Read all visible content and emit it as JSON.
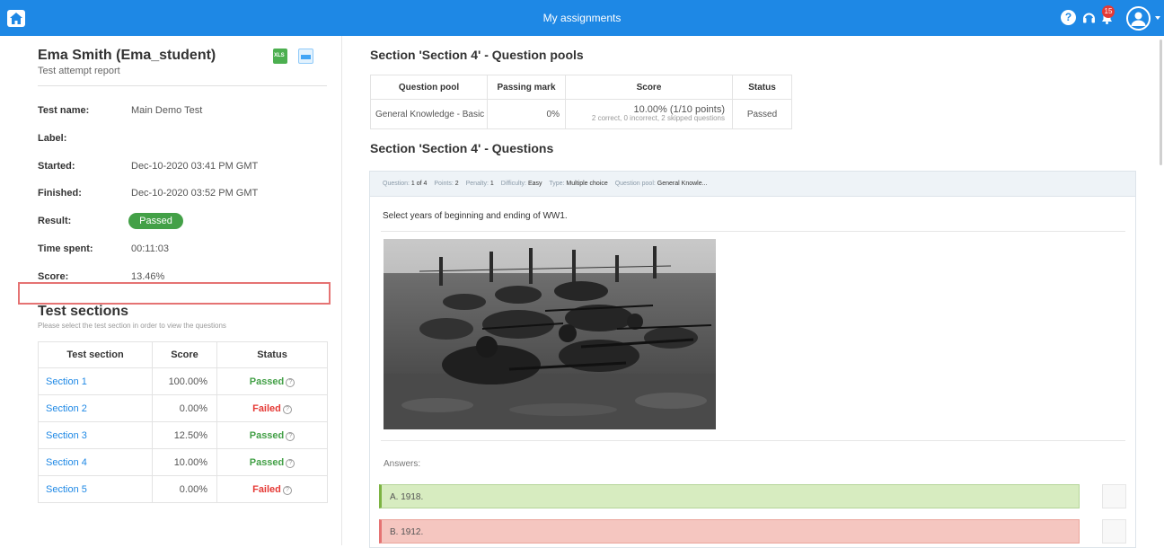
{
  "topbar": {
    "title": "My assignments",
    "notification_count": "15",
    "accent_color": "#1e88e5",
    "icons": [
      "home-icon",
      "help-icon",
      "headset-icon",
      "bell-icon",
      "user-avatar-icon"
    ]
  },
  "report": {
    "student": "Ema Smith (Ema_student)",
    "subtitle": "Test attempt report",
    "export_icons": [
      "xls-export-icon",
      "document-report-icon"
    ],
    "fields": {
      "test_name_label": "Test name:",
      "test_name": "Main Demo Test",
      "label_label": "Label:",
      "label": "",
      "started_label": "Started:",
      "started": "Dec-10-2020 03:41 PM GMT",
      "finished_label": "Finished:",
      "finished": "Dec-10-2020 03:52 PM GMT",
      "result_label": "Result:",
      "result": "Passed",
      "time_spent_label": "Time spent:",
      "time_spent": "00:11:03",
      "score_label": "Score:",
      "score": "13.46%"
    }
  },
  "sections": {
    "title": "Test sections",
    "hint": "Please select the test section in order to view the questions",
    "headers": [
      "Test section",
      "Score",
      "Status"
    ],
    "rows": [
      {
        "name": "Section 1",
        "score": "100.00%",
        "status": "Passed"
      },
      {
        "name": "Section 2",
        "score": "0.00%",
        "status": "Failed"
      },
      {
        "name": "Section 3",
        "score": "12.50%",
        "status": "Passed"
      },
      {
        "name": "Section 4",
        "score": "10.00%",
        "status": "Passed"
      },
      {
        "name": "Section 5",
        "score": "0.00%",
        "status": "Failed"
      }
    ],
    "status_colors": {
      "Passed": "#43a047",
      "Failed": "#e53935"
    }
  },
  "pools": {
    "title": "Section 'Section 4' - Question pools",
    "headers": [
      "Question pool",
      "Passing mark",
      "Score",
      "Status"
    ],
    "row": {
      "name": "General Knowledge - Basic",
      "passing_mark": "0%",
      "score": "10.00% (1/10 points)",
      "score_detail": "2 correct, 0 incorrect, 2 skipped questions",
      "status": "Passed"
    }
  },
  "questions": {
    "title": "Section 'Section 4' - Questions",
    "meta": {
      "question_label": "Question:",
      "question_value": "1 of 4",
      "points_label": "Points:",
      "points_value": "2",
      "penalty_label": "Penalty:",
      "penalty_value": "1",
      "difficulty_label": "Difficulty:",
      "difficulty_value": "Easy",
      "type_label": "Type:",
      "type_value": "Multiple choice",
      "pool_label": "Question pool:",
      "pool_value": "General Knowle..."
    },
    "text": "Select years of beginning and ending of WW1.",
    "image_icon": "ww1-soldiers-photo",
    "answers_label": "Answers:",
    "answers": [
      {
        "text": "A.  1918.",
        "state": "correct"
      },
      {
        "text": "B.  1912.",
        "state": "incorrect"
      }
    ]
  }
}
